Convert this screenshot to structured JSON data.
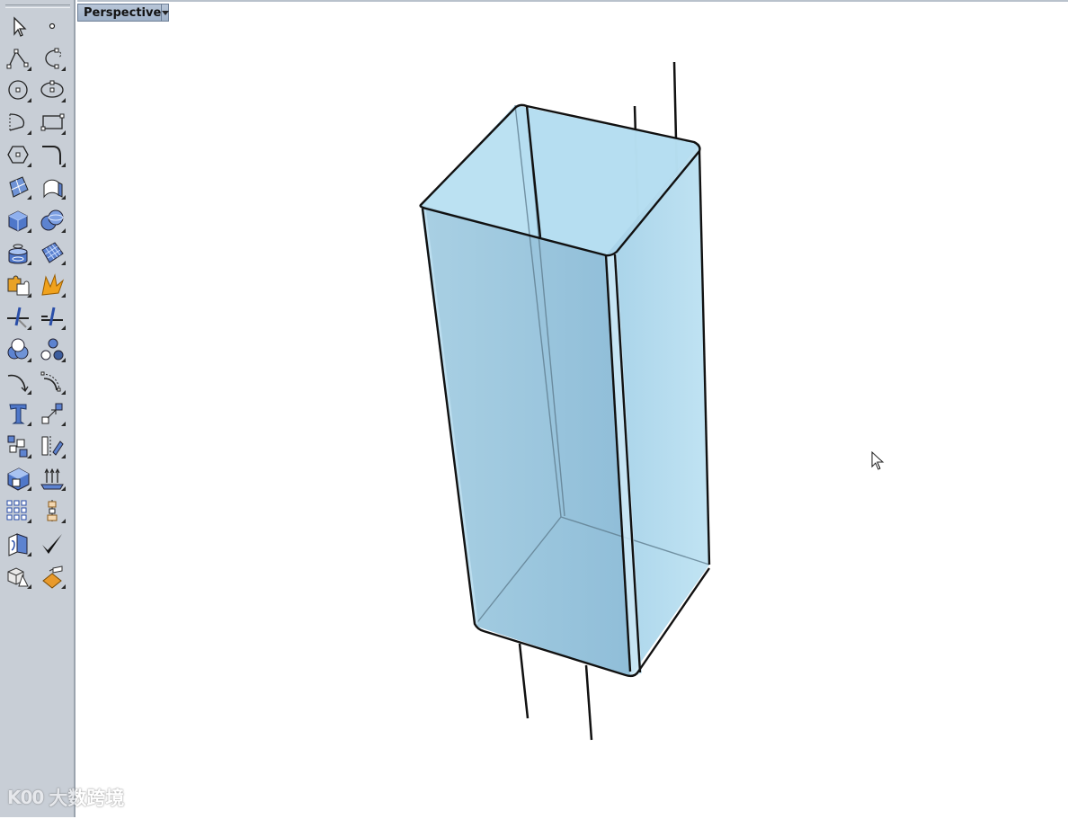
{
  "viewport": {
    "title": "Perspective"
  },
  "watermark": {
    "logo": "K00",
    "text": "大数跨境"
  },
  "toolbar": {
    "rows": [
      [
        "select-arrow-icon",
        "point-icon"
      ],
      [
        "polyline-icon",
        "curve-icon"
      ],
      [
        "circle-icon",
        "ellipse-icon"
      ],
      [
        "arc-icon",
        "rectangle-icon"
      ],
      [
        "polygon-icon",
        "fillet-curve-icon"
      ],
      [
        "surface-from-points-icon",
        "extrude-surface-icon"
      ],
      [
        "box-icon",
        "sphere-icon"
      ],
      [
        "cylinder-icon",
        "surface-mesh-icon"
      ],
      [
        "puzzle-icon",
        "explode-icon"
      ],
      [
        "trim-icon",
        "split-icon"
      ],
      [
        "boolean-union-icon",
        "boolean-split-icon"
      ],
      [
        "offset-curve-icon",
        "curve-blend-icon"
      ],
      [
        "text-icon",
        "scale-icon"
      ],
      [
        "group-icon",
        "mirror-icon"
      ],
      [
        "solid-edit-icon",
        "extrude-faces-icon"
      ],
      [
        "array-icon",
        "align-icon"
      ],
      [
        "analyze-icon",
        "check-icon"
      ],
      [
        "render-mesh-icon",
        "material-icon"
      ]
    ]
  },
  "colors": {
    "toolbar_bg": "#c8ced6",
    "tab_bg": "#a9b9ce",
    "box_fill": "#9cc6dd",
    "box_edge": "#111111"
  }
}
